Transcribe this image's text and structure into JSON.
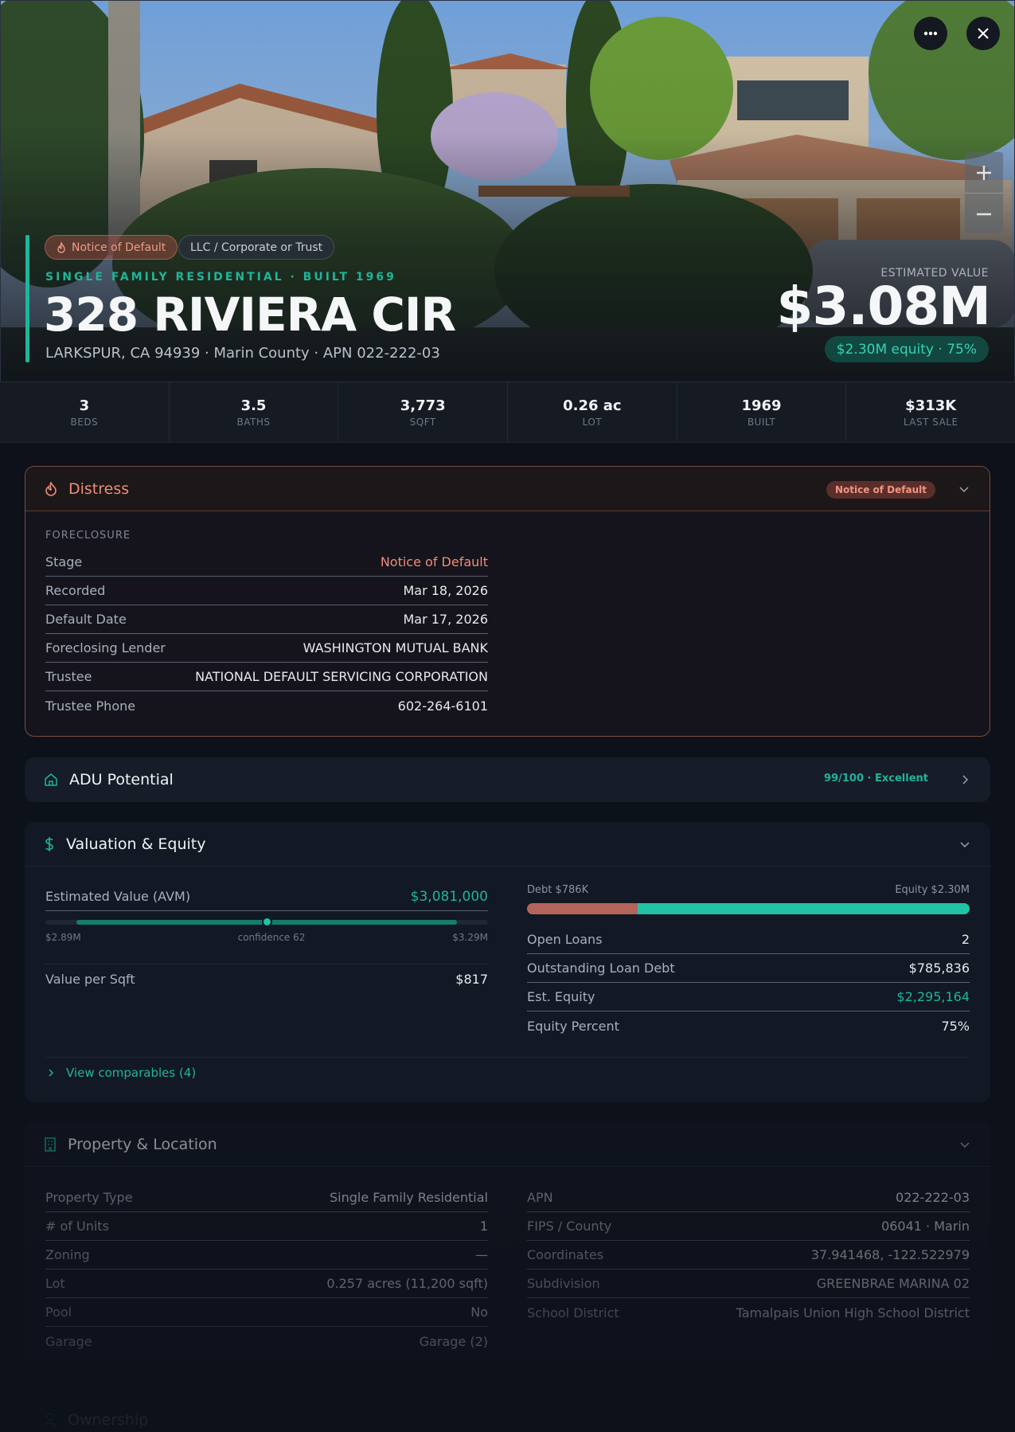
{
  "hero": {
    "badge_distress": "Notice of Default",
    "badge_owner": "LLC / Corporate or Trust",
    "eyebrow": "SINGLE FAMILY RESIDENTIAL · BUILT 1969",
    "address": "328 RIVIERA CIR",
    "subline": "LARKSPUR, CA 94939 · Marin County · APN 022-222-03",
    "est_label": "ESTIMATED VALUE",
    "est_value": "$3.08M",
    "equity_pill": "$2.30M equity · 75%"
  },
  "stats": [
    {
      "value": "3",
      "label": "BEDS"
    },
    {
      "value": "3.5",
      "label": "BATHS"
    },
    {
      "value": "3,773",
      "label": "SQFT"
    },
    {
      "value": "0.26 ac",
      "label": "LOT"
    },
    {
      "value": "1969",
      "label": "BUILT"
    },
    {
      "value": "$313K",
      "label": "LAST SALE"
    }
  ],
  "distress": {
    "title": "Distress",
    "badge": "Notice of Default",
    "section": "FORECLOSURE",
    "rows": [
      {
        "k": "Stage",
        "v": "Notice of Default"
      },
      {
        "k": "Recorded",
        "v": "Mar 18, 2026"
      },
      {
        "k": "Default Date",
        "v": "Mar 17, 2026"
      },
      {
        "k": "Foreclosing Lender",
        "v": "WASHINGTON MUTUAL BANK"
      },
      {
        "k": "Trustee",
        "v": "NATIONAL DEFAULT SERVICING CORPORATION"
      },
      {
        "k": "Trustee Phone",
        "v": "602-264-6101"
      }
    ]
  },
  "adu": {
    "title": "ADU Potential",
    "score": "99/100 · Excellent"
  },
  "valuation": {
    "title": "Valuation & Equity",
    "avm_label": "Estimated Value (AVM)",
    "avm_value": "$3,081,000",
    "range_low": "$2.89M",
    "range_high": "$3.29M",
    "confidence": "confidence 62",
    "confidence_value": 62,
    "ppsf_label": "Value per Sqft",
    "ppsf_value": "$817",
    "debt_label": "Debt $786K",
    "equity_label": "Equity $2.30M",
    "debt_fraction": 0.25,
    "rows": [
      {
        "k": "Open Loans",
        "v": "2"
      },
      {
        "k": "Outstanding Loan Debt",
        "v": "$785,836"
      },
      {
        "k": "Est. Equity",
        "v": "$2,295,164"
      },
      {
        "k": "Equity Percent",
        "v": "75%"
      }
    ],
    "comparables_link": "View comparables (4)"
  },
  "property": {
    "title": "Property & Location",
    "left_rows": [
      {
        "k": "Property Type",
        "v": "Single Family Residential"
      },
      {
        "k": "# of Units",
        "v": "1"
      },
      {
        "k": "Zoning",
        "v": "—"
      },
      {
        "k": "Lot",
        "v": "0.257 acres (11,200 sqft)"
      },
      {
        "k": "Pool",
        "v": "No"
      },
      {
        "k": "Garage",
        "v": "Garage (2)"
      }
    ],
    "right_rows": [
      {
        "k": "APN",
        "v": "022-222-03"
      },
      {
        "k": "FIPS / County",
        "v": "06041 · Marin"
      },
      {
        "k": "Coordinates",
        "v": "37.941468, -122.522979"
      },
      {
        "k": "Subdivision",
        "v": "GREENBRAE MARINA 02"
      },
      {
        "k": "School District",
        "v": "Tamalpais Union High School District"
      }
    ]
  },
  "ownership": {
    "title": "Ownership"
  },
  "colors": {
    "accent": "#1fb59b",
    "distress": "#ef8d78",
    "debt": "#b5645a",
    "background": "#0d111a"
  }
}
